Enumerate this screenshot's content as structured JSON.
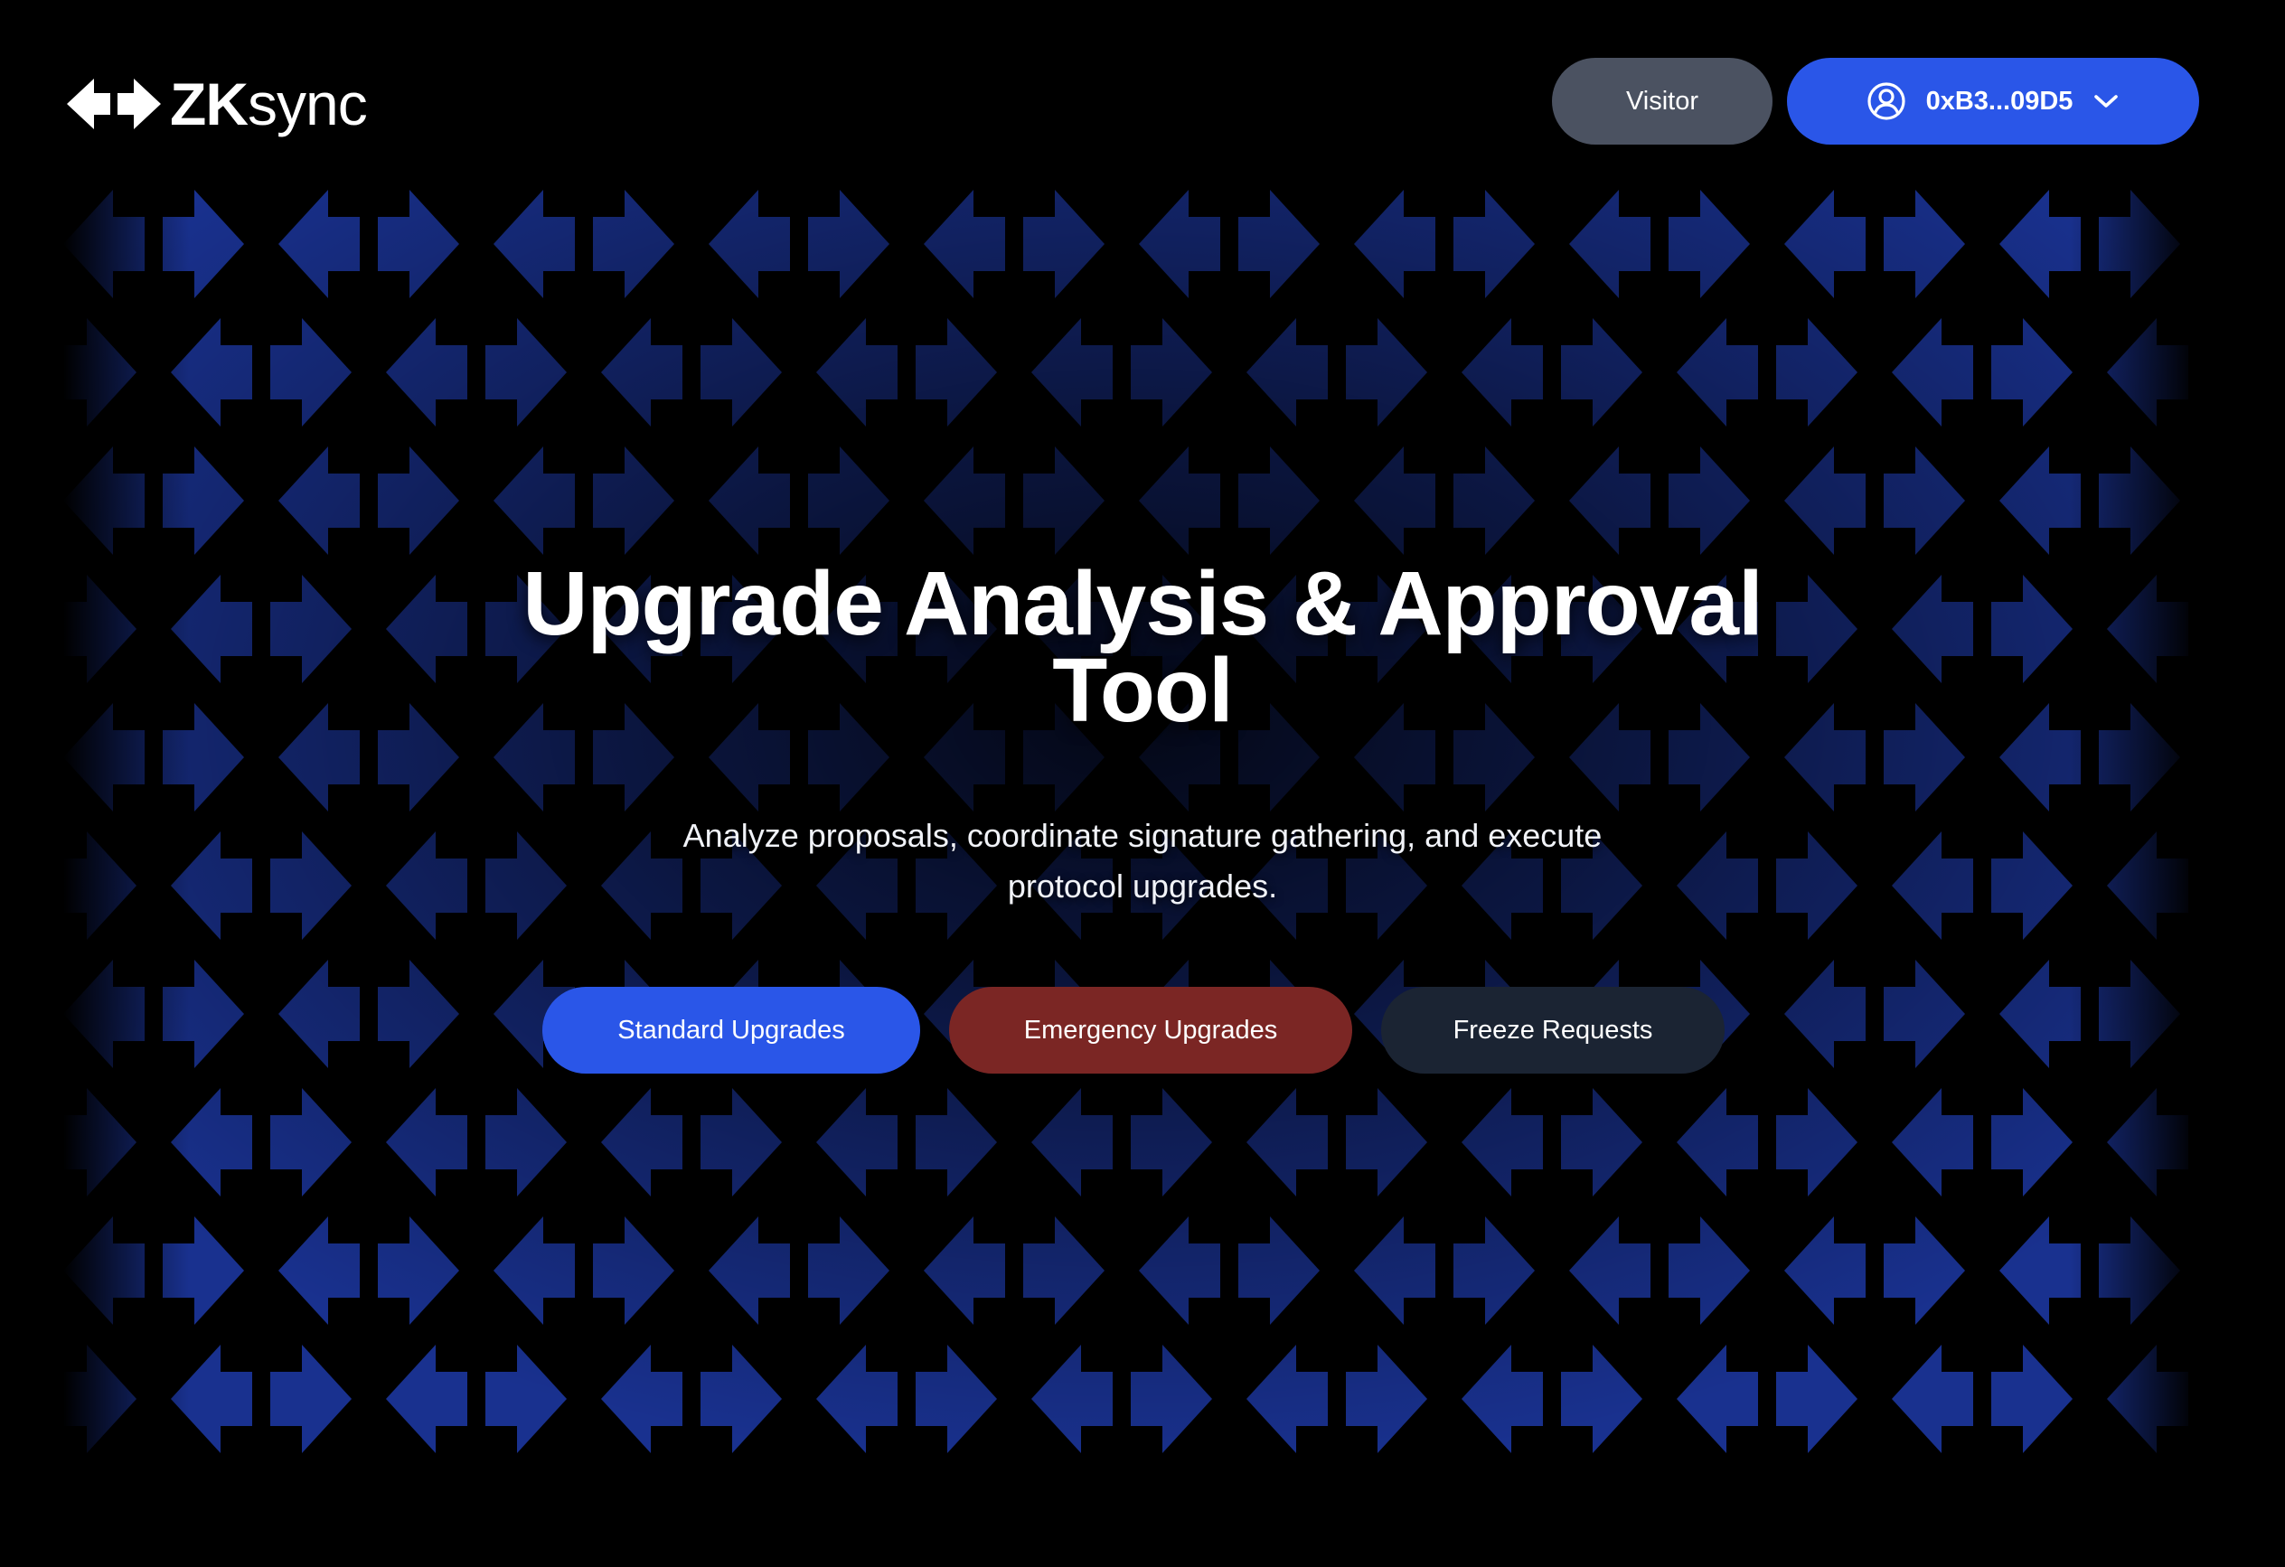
{
  "app": {
    "logo_zk": "ZK",
    "logo_sync": "sync"
  },
  "header": {
    "visitor_label": "Visitor",
    "account_label": "0xB3...09D5"
  },
  "hero": {
    "title": "Upgrade Analysis & Approval Tool",
    "subtitle": "Analyze proposals, coordinate signature gathering, and execute protocol upgrades."
  },
  "actions": {
    "standard": "Standard Upgrades",
    "emergency": "Emergency Upgrades",
    "freeze": "Freeze Requests"
  },
  "colors": {
    "background": "#000000",
    "accent_blue": "#2a56e8",
    "emergency_red": "#7b2624",
    "freeze_dark": "#1b2433",
    "visitor_gray": "#4b5261",
    "pattern_blue": "#1d3aa8"
  },
  "icons": {
    "logo": "zksync-arrows-logo",
    "account": "user-circle-icon",
    "dropdown": "chevron-down-icon",
    "pattern": "arrow-pattern-background"
  }
}
